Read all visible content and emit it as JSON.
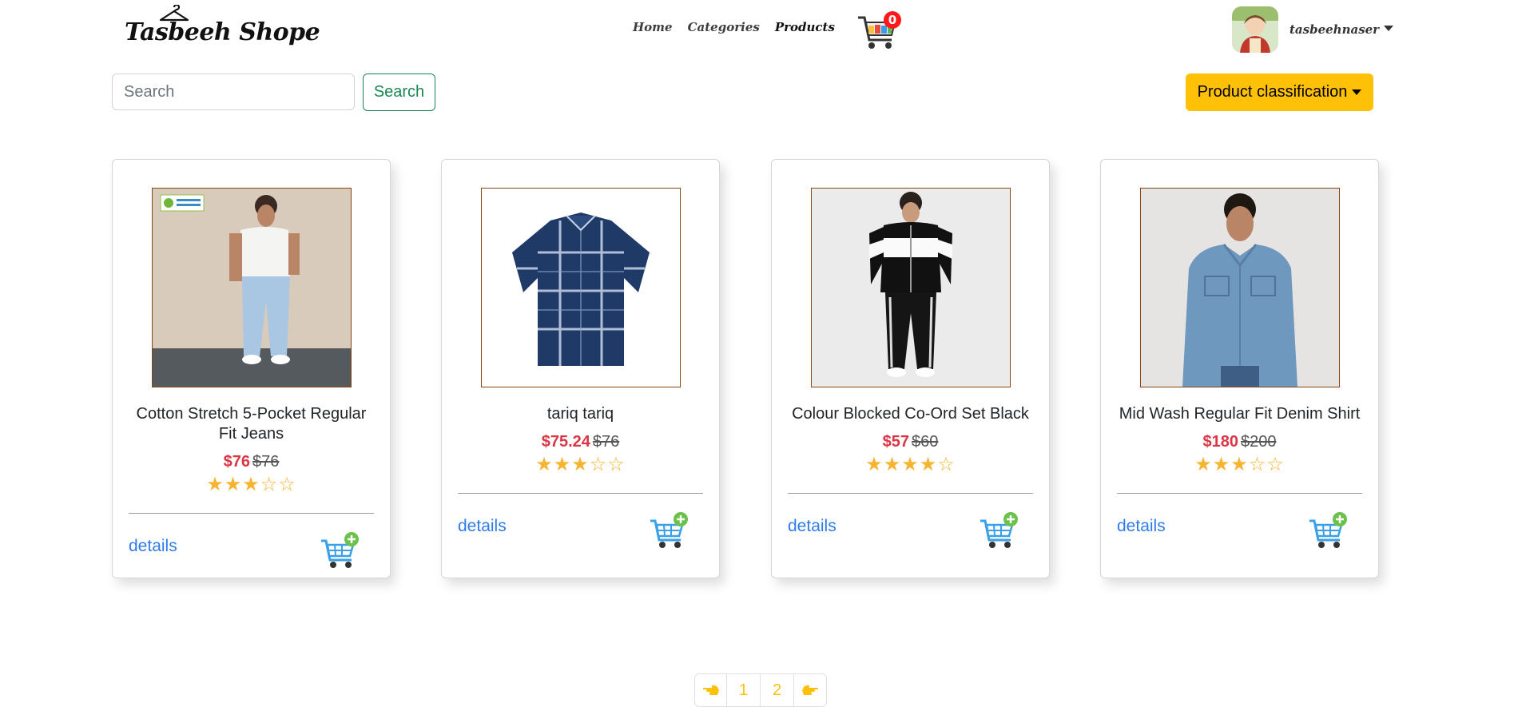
{
  "brand": {
    "name": "Tasbeeh Shope"
  },
  "nav": {
    "links": [
      "Home",
      "Categories",
      "Products"
    ],
    "cart_count": "0"
  },
  "user": {
    "name": "tasbeehnaser"
  },
  "search": {
    "placeholder": "Search",
    "button_label": "Search"
  },
  "classification": {
    "label": "Product classification"
  },
  "products": [
    {
      "title": "Cotton Stretch 5-Pocket Regular Fit Jeans",
      "price": "$76",
      "old_price": "$76",
      "rating": 3,
      "max_rating": 5,
      "details_label": "details"
    },
    {
      "title": "tariq tariq",
      "price": "$75.24",
      "old_price": "$76",
      "rating": 3,
      "max_rating": 5,
      "details_label": "details"
    },
    {
      "title": "Colour Blocked Co-Ord Set Black",
      "price": "$57",
      "old_price": "$60",
      "rating": 4,
      "max_rating": 5,
      "details_label": "details"
    },
    {
      "title": "Mid Wash Regular Fit Denim Shirt",
      "price": "$180",
      "old_price": "$200",
      "rating": 3,
      "max_rating": 5,
      "details_label": "details"
    }
  ],
  "pagination": {
    "pages": [
      "1",
      "2"
    ]
  },
  "colors": {
    "accent": "#ffc107",
    "price": "#dc3545",
    "link": "#2f7ce9",
    "search_button": "#198754",
    "badge": "#ff1a1a"
  },
  "icons": {
    "cart": "shopping-cart-icon",
    "add_to_cart": "add-to-cart-icon",
    "prev": "pointing-left-hand-icon",
    "next": "pointing-right-hand-icon"
  }
}
